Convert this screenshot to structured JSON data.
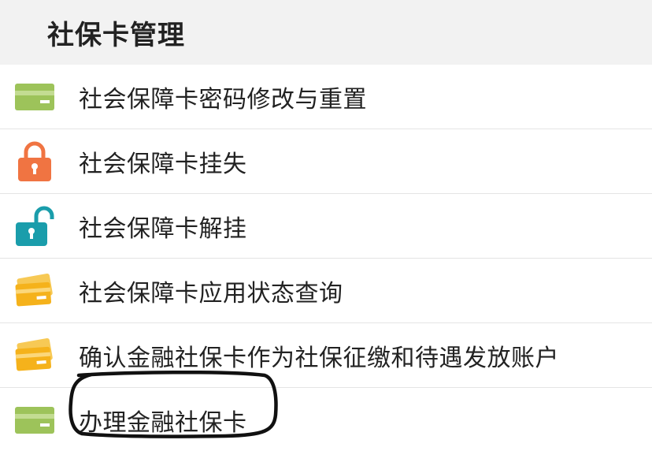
{
  "header": {
    "title": "社保卡管理"
  },
  "items": [
    {
      "label": "社会保障卡密码修改与重置",
      "icon": "green-card-icon"
    },
    {
      "label": "社会保障卡挂失",
      "icon": "locked-padlock-icon"
    },
    {
      "label": "社会保障卡解挂",
      "icon": "unlocked-padlock-icon"
    },
    {
      "label": "社会保障卡应用状态查询",
      "icon": "yellow-cards-icon"
    },
    {
      "label": "确认金融社保卡作为社保征缴和待遇发放账户",
      "icon": "yellow-cards-icon"
    },
    {
      "label": "办理金融社保卡",
      "icon": "green-card-icon"
    }
  ],
  "colors": {
    "header_bg": "#f2f2f2",
    "green_card": "#9dc35a",
    "lock_orange": "#f07442",
    "lock_teal": "#1a9dab",
    "cards_yellow": "#f5b21b",
    "annotation_ink": "#111111"
  }
}
